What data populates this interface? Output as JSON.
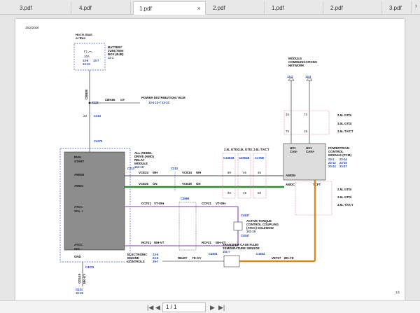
{
  "tabs": [
    {
      "label": "3.pdf"
    },
    {
      "label": "4.pdf"
    },
    {
      "label": "1.pdf",
      "active": true,
      "close": "×"
    },
    {
      "label": "2.pdf"
    },
    {
      "label": "1.pdf"
    },
    {
      "label": "2.pdf"
    },
    {
      "label": "3.pdf"
    }
  ],
  "tab_more": "›",
  "doc": {
    "date": "15/2/2020",
    "page_footer": "1/1",
    "hot": "Hot in Start",
    "or_run": "or Run",
    "bjb": [
      "BATTERY",
      "JUNCTION",
      "BOX (BJB)",
      "11-1"
    ],
    "fuse": [
      "F1",
      "10A",
      "13-6",
      "13-7",
      "13-10"
    ],
    "pd": "POWER DISTRIBUTION / BCM",
    "pd_refs": "13-4   13-7   13-10",
    "cbk": "CBK85",
    "gy": "GY",
    "s113": "S113",
    "c213": "C213",
    "n23": "23",
    "c4379": "C4379",
    "cbb80": "CBB80",
    "awd_title": [
      "ALL WHEEL",
      "DRIVE (AWD)",
      "RELAY",
      "MODULE",
      "151-16"
    ],
    "awd_pins": [
      "RUN",
      "START",
      "AWDM",
      "AWDC",
      "ATCC",
      "SOL +",
      "ATCC",
      "SOL -",
      "GND"
    ],
    "wires": [
      "VCE34",
      "WH",
      "VCE35",
      "GN",
      "VCE34",
      "WH",
      "VCE35",
      "GN",
      "CCF21",
      "VT-WH",
      "CCF21",
      "VT-WH",
      "RCF21",
      "WH-VT",
      "RCF21",
      "WH-VT"
    ],
    "conns": [
      "C213",
      "C213",
      "C3669",
      "C4547",
      "C4547",
      "C4379",
      "C1381B",
      "C3551B",
      "C175B",
      "C1834",
      "C1834"
    ],
    "atcc": [
      "ACTIVE TORQUE",
      "CONTROL COUPLING",
      "(ATCC) SOLENOID",
      "151-16"
    ],
    "config": [
      "2.5L GTDi",
      "3.5L GTDi",
      "3.5L TiVCT"
    ],
    "net": [
      "MODULE",
      "COMMUNICATIONS",
      "NETWORK",
      "14-2",
      "14-2"
    ],
    "pcm": [
      "POWERTRAIN",
      "CONTROL",
      "MODULE (PCM)",
      "23-1",
      "23-14",
      "23-12",
      "23-15",
      "23-24",
      "23-37"
    ],
    "pcm_pins": [
      "HS1",
      "CAN-",
      "HS1",
      "CAN+",
      "AWDM",
      "AWDC",
      "TCFT"
    ],
    "tcft": [
      "TRANSFER CASE FLUID",
      "TEMPERATURE SENSOR",
      "151-7"
    ],
    "ecm": [
      "ELECTRONIC",
      "ENGINE",
      "CONTROLS"
    ],
    "ecm_refs": [
      "23-5",
      "24-5",
      "29-7"
    ],
    "re": "RE407",
    "yegy": "YE-GY",
    "vet": "VET27",
    "bnye": "BN-YE",
    "gnd": [
      "GD149",
      "BK-GY",
      "G101",
      "10-18"
    ],
    "pins": [
      "69",
      "69",
      "76",
      "46",
      "46",
      "49",
      "69",
      "45",
      "73",
      "18",
      "16",
      "49",
      "95",
      "40",
      "24",
      "52",
      "21",
      "11",
      "4",
      "5",
      "8",
      "9",
      "1",
      "3",
      "2"
    ]
  },
  "pager": {
    "first": "|◀",
    "prev": "◀",
    "page": "1 / 1",
    "next": "▶",
    "last": "▶|"
  },
  "colors": {
    "green": "#2e8b2e",
    "violet": "#b07ad0",
    "orange": "#d98a1c",
    "blue_box": "#3a4cc7",
    "pink": "#d07ab0"
  }
}
